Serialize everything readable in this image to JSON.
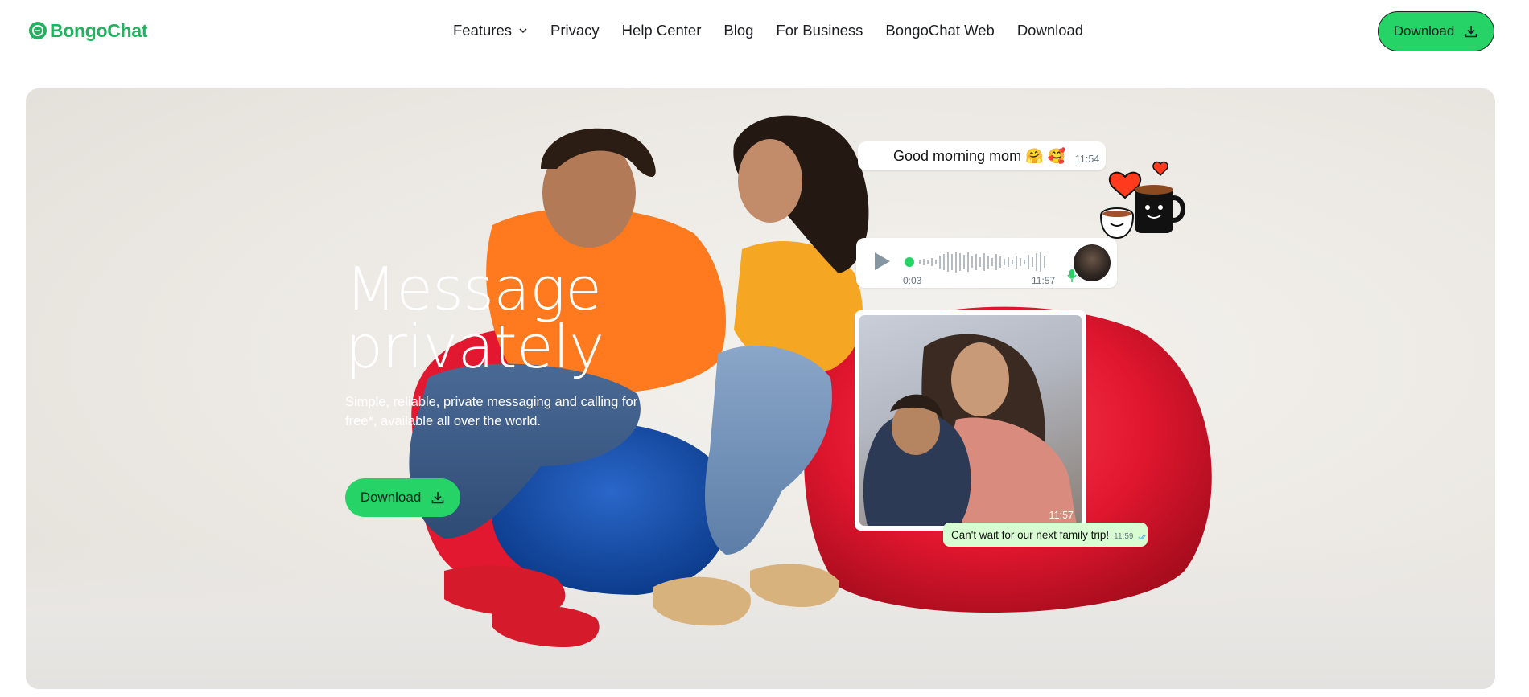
{
  "brand": {
    "name": "BongoChat",
    "color": "#25b060"
  },
  "nav": {
    "items": [
      {
        "label": "Features",
        "has_dropdown": true,
        "icon": "chevron-down-icon"
      },
      {
        "label": "Privacy"
      },
      {
        "label": "Help Center"
      },
      {
        "label": "Blog"
      },
      {
        "label": "For Business"
      },
      {
        "label": "BongoChat Web"
      },
      {
        "label": "Download"
      }
    ],
    "download_button": {
      "label": "Download",
      "icon": "download-icon"
    }
  },
  "hero": {
    "title_line1": "Message",
    "title_line2": "privately",
    "subtitle": "Simple, reliable, private messaging and calling for free*, available all over the world.",
    "download_button": {
      "label": "Download",
      "icon": "download-icon"
    },
    "accent_color": "#25d366"
  },
  "chat": {
    "message1": {
      "text": "Good morning mom 🤗 🥰",
      "time": "11:54"
    },
    "voice_note": {
      "elapsed": "0:03",
      "time": "11:57",
      "icon": "play-icon"
    },
    "photo": {
      "time": "11:57"
    },
    "message2": {
      "text": "Can't wait for our next family trip!",
      "time": "11:59",
      "status_icon": "double-check-icon"
    }
  }
}
